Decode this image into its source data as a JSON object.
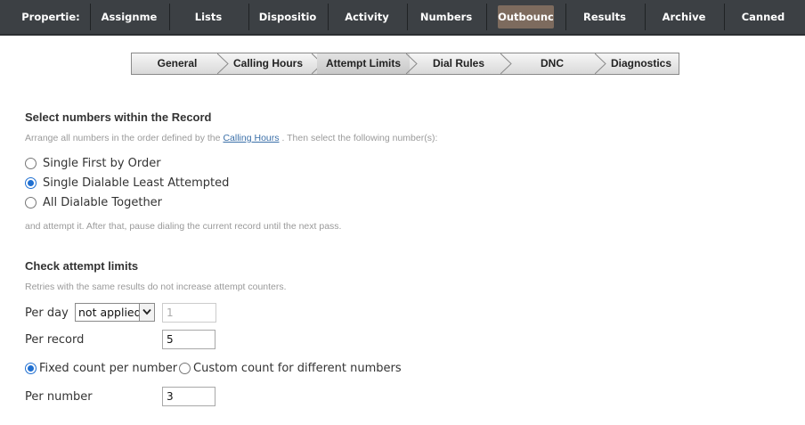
{
  "top_tabs": [
    {
      "label": "Propertie:"
    },
    {
      "label": "Assignme"
    },
    {
      "label": "Lists"
    },
    {
      "label": "Dispositio"
    },
    {
      "label": "Activity"
    },
    {
      "label": "Numbers"
    },
    {
      "label": "Outbounc"
    },
    {
      "label": "Results"
    },
    {
      "label": "Archive"
    },
    {
      "label": "Canned"
    }
  ],
  "active_top_tab": "Outbounc",
  "sub_tabs": [
    {
      "label": "General"
    },
    {
      "label": "Calling Hours"
    },
    {
      "label": "Attempt Limits"
    },
    {
      "label": "Dial Rules"
    },
    {
      "label": "DNC"
    },
    {
      "label": "Diagnostics"
    }
  ],
  "active_sub_tab": "Attempt Limits",
  "select_numbers": {
    "title": "Select numbers within the Record",
    "hint_before": "Arrange all numbers in the order defined by the",
    "hint_link": "Calling Hours",
    "hint_after": ". Then select the following number(s):",
    "options": [
      {
        "label": "Single First by Order",
        "checked": false
      },
      {
        "label": "Single Dialable Least Attempted",
        "checked": true
      },
      {
        "label": "All Dialable Together",
        "checked": false
      }
    ],
    "footer": "and attempt it. After that, pause dialing the current record until the next pass."
  },
  "attempt_limits": {
    "title": "Check attempt limits",
    "hint": "Retries with the same results do not increase attempt counters.",
    "per_day_label": "Per day",
    "per_day_select": "not applied",
    "per_day_value": "1",
    "per_record_label": "Per record",
    "per_record_value": "5",
    "fixed_label": "Fixed count per number",
    "fixed_checked": true,
    "custom_label": "Custom count for different numbers",
    "custom_checked": false,
    "per_number_label": "Per number",
    "per_number_value": "3"
  },
  "colors": {
    "topbar_bg": "#3c4044",
    "active_top_tab_bg": "#7d6b5e",
    "radio_accent": "#1f6fd1",
    "link": "#3a6fa8",
    "hint": "#9a9a9a"
  }
}
